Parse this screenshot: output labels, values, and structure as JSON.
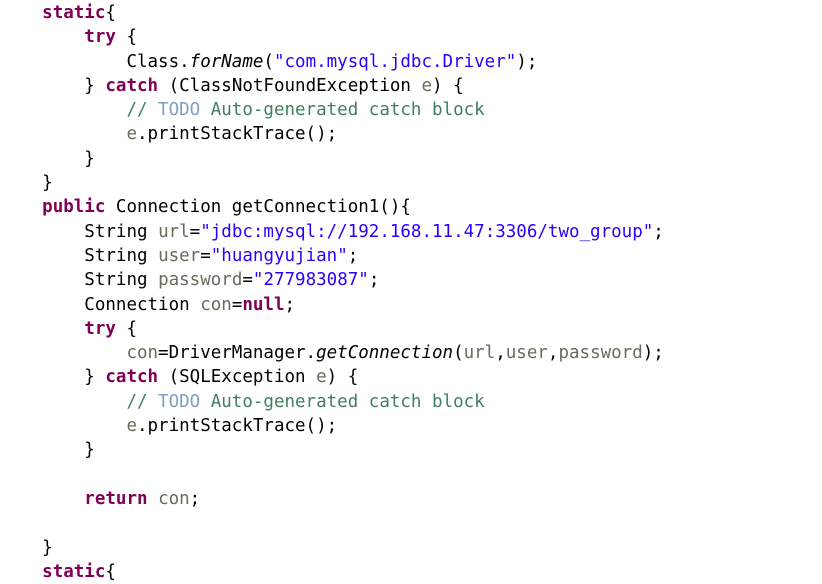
{
  "editor": {
    "language": "java",
    "theme": "eclipse-light",
    "background_color": "#ffffff",
    "font_size_px": 17.5,
    "line_height_px": 24.3,
    "colors": {
      "keyword": "#7F0055",
      "string": "#2A00FF",
      "comment": "#3F7F5F",
      "todo_tag": "#7F9FBF",
      "field": "#6A6A5A",
      "plain": "#000000"
    }
  },
  "code": {
    "lines": [
      {
        "id": "line-1",
        "indent": 4,
        "tokens": [
          {
            "t": "kw",
            "v": "static"
          },
          {
            "t": "plain",
            "v": "{"
          }
        ]
      },
      {
        "id": "line-2",
        "indent": 8,
        "tokens": [
          {
            "t": "kw",
            "v": "try"
          },
          {
            "t": "plain",
            "v": " {"
          }
        ]
      },
      {
        "id": "line-3",
        "indent": 12,
        "tokens": [
          {
            "t": "plain",
            "v": "Class."
          },
          {
            "t": "stm",
            "v": "forName"
          },
          {
            "t": "plain",
            "v": "("
          },
          {
            "t": "str",
            "v": "\"com.mysql.jdbc.Driver\""
          },
          {
            "t": "plain",
            "v": ");"
          }
        ]
      },
      {
        "id": "line-4",
        "indent": 8,
        "tokens": [
          {
            "t": "plain",
            "v": "} "
          },
          {
            "t": "kw",
            "v": "catch"
          },
          {
            "t": "plain",
            "v": " (ClassNotFoundException "
          },
          {
            "t": "fld",
            "v": "e"
          },
          {
            "t": "plain",
            "v": ") {"
          }
        ]
      },
      {
        "id": "line-5",
        "indent": 12,
        "tokens": [
          {
            "t": "cmt",
            "v": "// "
          },
          {
            "t": "todo",
            "v": "TODO"
          },
          {
            "t": "cmt",
            "v": " Auto-generated catch block"
          }
        ]
      },
      {
        "id": "line-6",
        "indent": 12,
        "tokens": [
          {
            "t": "fld",
            "v": "e"
          },
          {
            "t": "plain",
            "v": ".printStackTrace();"
          }
        ]
      },
      {
        "id": "line-7",
        "indent": 8,
        "tokens": [
          {
            "t": "plain",
            "v": "}"
          }
        ]
      },
      {
        "id": "line-8",
        "indent": 4,
        "tokens": [
          {
            "t": "plain",
            "v": "}"
          }
        ]
      },
      {
        "id": "line-9",
        "indent": 4,
        "tokens": [
          {
            "t": "kw",
            "v": "public"
          },
          {
            "t": "plain",
            "v": " Connection getConnection1(){"
          }
        ]
      },
      {
        "id": "line-10",
        "indent": 8,
        "tokens": [
          {
            "t": "plain",
            "v": "String "
          },
          {
            "t": "fld",
            "v": "url"
          },
          {
            "t": "plain",
            "v": "="
          },
          {
            "t": "str",
            "v": "\"jdbc:mysql://192.168.11.47:3306/two_group\""
          },
          {
            "t": "plain",
            "v": ";"
          }
        ]
      },
      {
        "id": "line-11",
        "indent": 8,
        "tokens": [
          {
            "t": "plain",
            "v": "String "
          },
          {
            "t": "fld",
            "v": "user"
          },
          {
            "t": "plain",
            "v": "="
          },
          {
            "t": "str",
            "v": "\"huangyujian\""
          },
          {
            "t": "plain",
            "v": ";"
          }
        ]
      },
      {
        "id": "line-12",
        "indent": 8,
        "tokens": [
          {
            "t": "plain",
            "v": "String "
          },
          {
            "t": "fld",
            "v": "password"
          },
          {
            "t": "plain",
            "v": "="
          },
          {
            "t": "str",
            "v": "\"277983087\""
          },
          {
            "t": "plain",
            "v": ";"
          }
        ]
      },
      {
        "id": "line-13",
        "indent": 8,
        "tokens": [
          {
            "t": "plain",
            "v": "Connection "
          },
          {
            "t": "fld",
            "v": "con"
          },
          {
            "t": "plain",
            "v": "="
          },
          {
            "t": "kw",
            "v": "null"
          },
          {
            "t": "plain",
            "v": ";"
          }
        ]
      },
      {
        "id": "line-14",
        "indent": 8,
        "tokens": [
          {
            "t": "kw",
            "v": "try"
          },
          {
            "t": "plain",
            "v": " {"
          }
        ]
      },
      {
        "id": "line-15",
        "indent": 12,
        "tokens": [
          {
            "t": "fld",
            "v": "con"
          },
          {
            "t": "plain",
            "v": "=DriverManager."
          },
          {
            "t": "stm",
            "v": "getConnection"
          },
          {
            "t": "plain",
            "v": "("
          },
          {
            "t": "fld",
            "v": "url"
          },
          {
            "t": "plain",
            "v": ","
          },
          {
            "t": "fld",
            "v": "user"
          },
          {
            "t": "plain",
            "v": ","
          },
          {
            "t": "fld",
            "v": "password"
          },
          {
            "t": "plain",
            "v": ");"
          }
        ]
      },
      {
        "id": "line-16",
        "indent": 8,
        "tokens": [
          {
            "t": "plain",
            "v": "} "
          },
          {
            "t": "kw",
            "v": "catch"
          },
          {
            "t": "plain",
            "v": " (SQLException "
          },
          {
            "t": "fld",
            "v": "e"
          },
          {
            "t": "plain",
            "v": ") {"
          }
        ]
      },
      {
        "id": "line-17",
        "indent": 12,
        "tokens": [
          {
            "t": "cmt",
            "v": "// "
          },
          {
            "t": "todo",
            "v": "TODO"
          },
          {
            "t": "cmt",
            "v": " Auto-generated catch block"
          }
        ]
      },
      {
        "id": "line-18",
        "indent": 12,
        "tokens": [
          {
            "t": "fld",
            "v": "e"
          },
          {
            "t": "plain",
            "v": ".printStackTrace();"
          }
        ]
      },
      {
        "id": "line-19",
        "indent": 8,
        "tokens": [
          {
            "t": "plain",
            "v": "}"
          }
        ]
      },
      {
        "id": "line-20",
        "indent": 0,
        "tokens": []
      },
      {
        "id": "line-21",
        "indent": 8,
        "tokens": [
          {
            "t": "kw",
            "v": "return"
          },
          {
            "t": "plain",
            "v": " "
          },
          {
            "t": "fld",
            "v": "con"
          },
          {
            "t": "plain",
            "v": ";"
          }
        ]
      },
      {
        "id": "line-22",
        "indent": 0,
        "tokens": []
      },
      {
        "id": "line-23",
        "indent": 4,
        "tokens": [
          {
            "t": "plain",
            "v": "}"
          }
        ]
      },
      {
        "id": "line-24",
        "indent": 4,
        "tokens": [
          {
            "t": "kw",
            "v": "static"
          },
          {
            "t": "plain",
            "v": "{"
          }
        ]
      }
    ]
  }
}
